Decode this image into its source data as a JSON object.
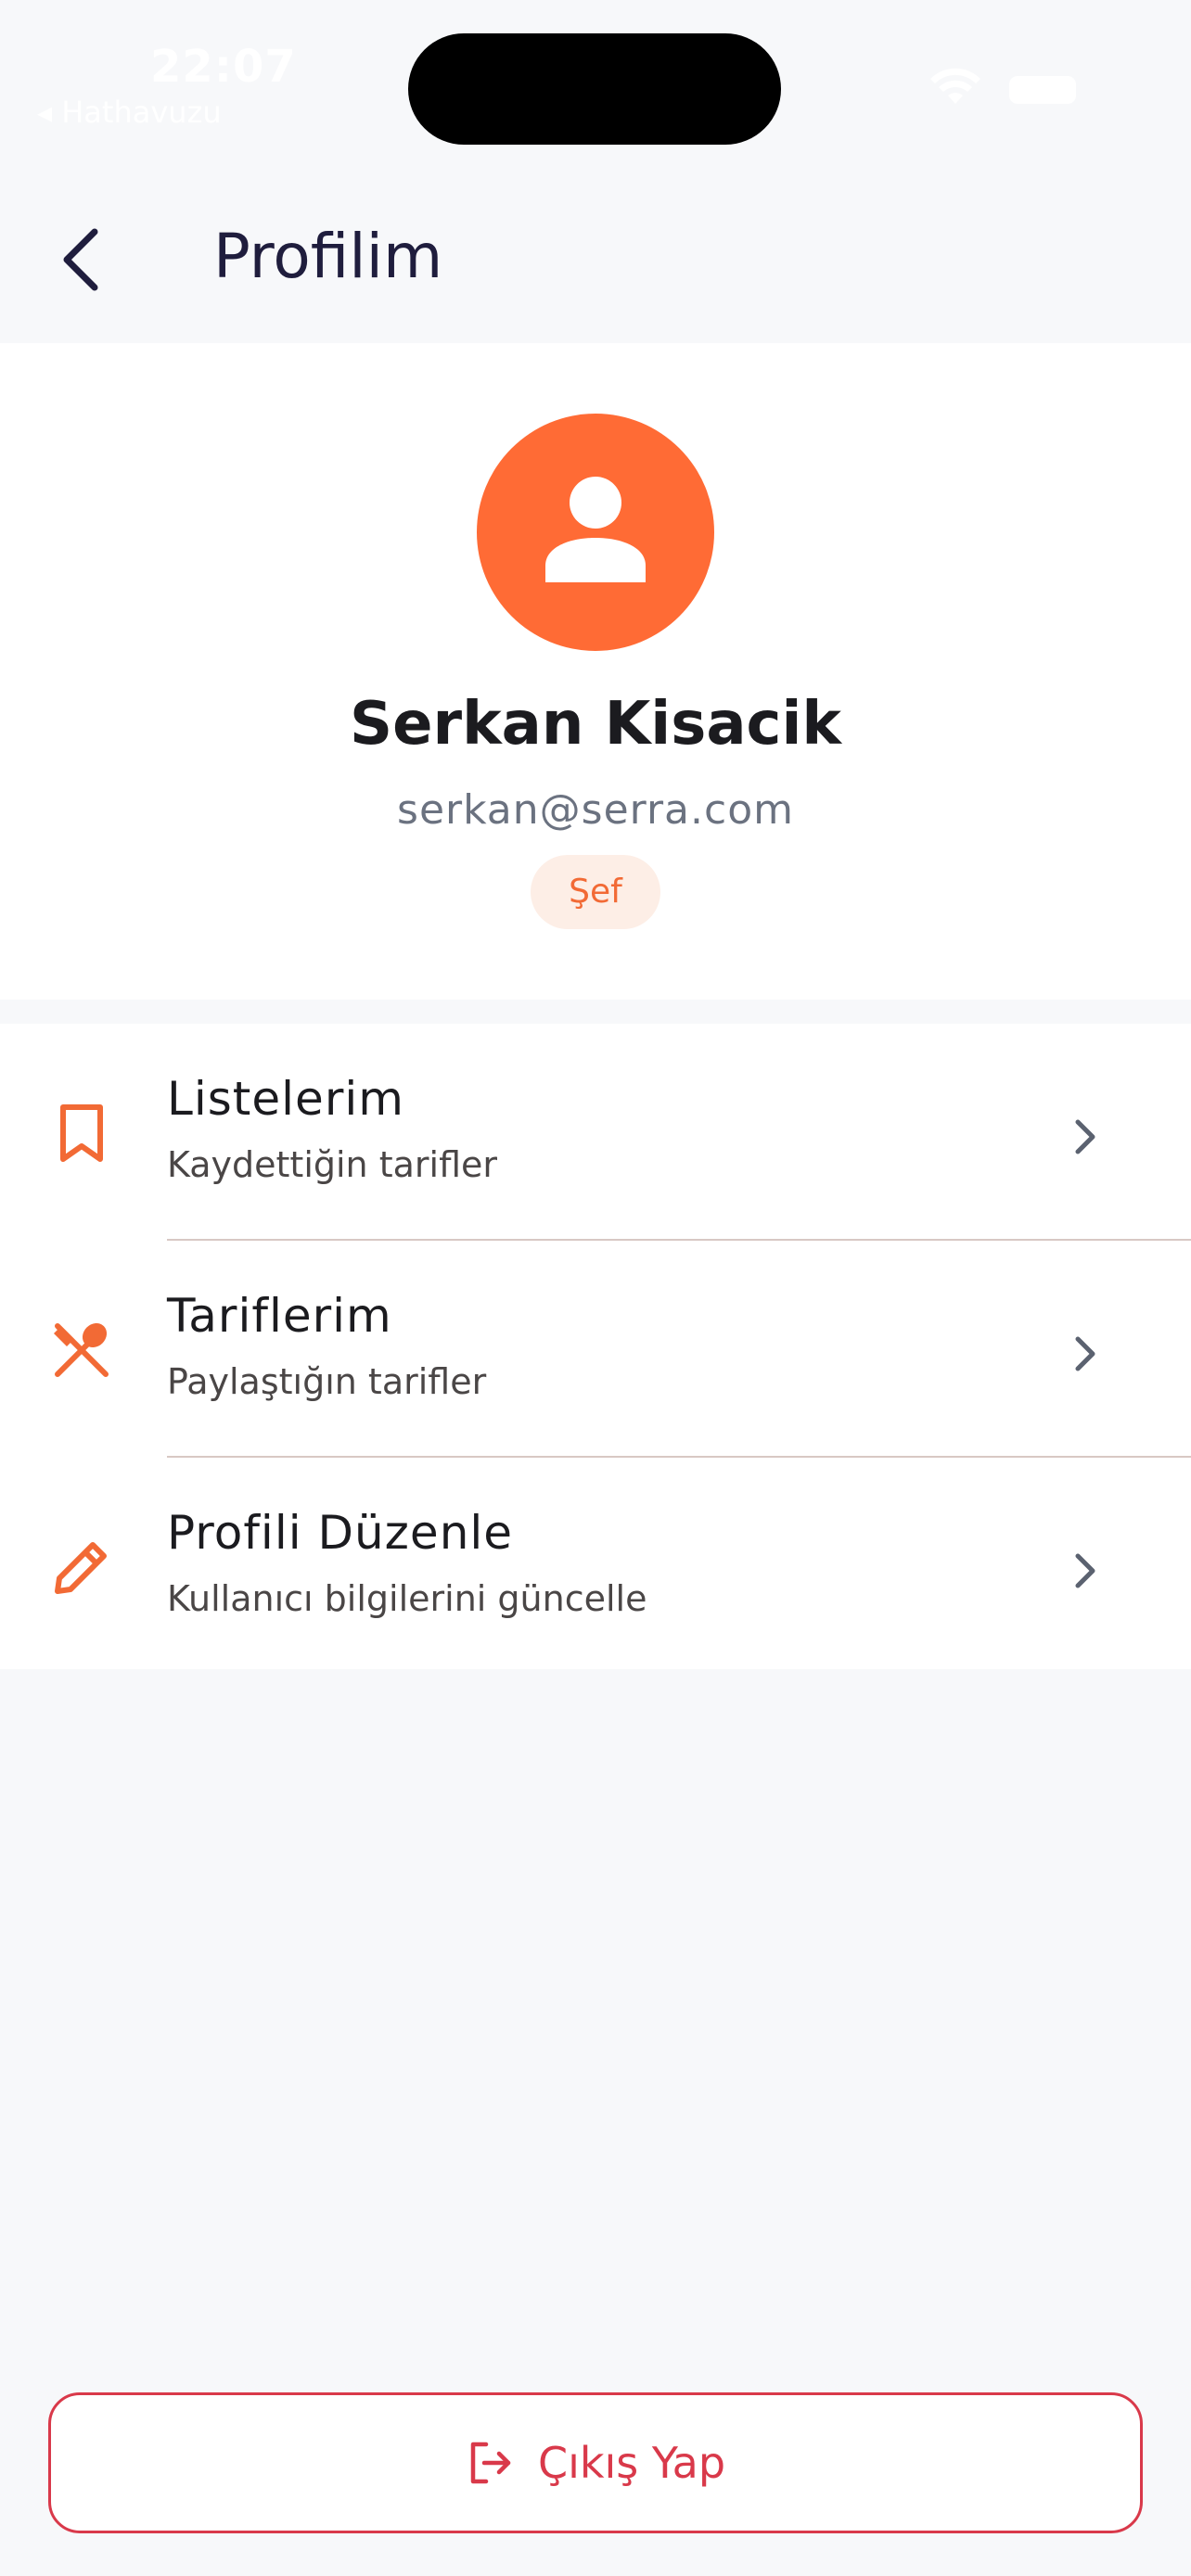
{
  "status_bar": {
    "time": "22:07",
    "back_app": "◂ Hathavuzu"
  },
  "header": {
    "title": "Profilim",
    "back_icon": "chevron-left-icon"
  },
  "profile": {
    "name": "Serkan Kisacik",
    "email": "serkan@serra.com",
    "role": "Şef",
    "avatar_icon": "person-icon",
    "avatar_color": "#ff6b35"
  },
  "menu": {
    "items": [
      {
        "title": "Listelerim",
        "subtitle": "Kaydettiğin tarifler",
        "icon": "bookmark-icon"
      },
      {
        "title": "Tariflerim",
        "subtitle": "Paylaştığın tarifler",
        "icon": "utensils-icon"
      },
      {
        "title": "Profili Düzenle",
        "subtitle": "Kullanıcı bilgilerini güncelle",
        "icon": "pencil-icon"
      }
    ]
  },
  "logout": {
    "label": "Çıkış Yap",
    "icon": "logout-icon",
    "color": "#d9394a"
  },
  "colors": {
    "accent": "#ff6b35",
    "background": "#f7f8fa",
    "danger": "#d9394a"
  }
}
